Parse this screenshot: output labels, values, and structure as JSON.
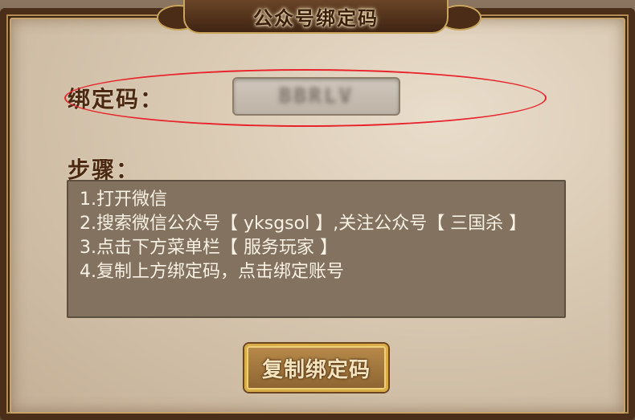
{
  "dialog": {
    "title": "公众号绑定码"
  },
  "code_row": {
    "label": "绑定码：",
    "value": "BBRLV"
  },
  "steps": {
    "label": "步骤：",
    "items": [
      "1.打开微信",
      "2.搜索微信公众号【 yksgsol 】,关注公众号【 三国杀 】",
      "3.点击下方菜单栏【 服务玩家 】",
      "4.复制上方绑定码，点击绑定账号"
    ]
  },
  "actions": {
    "copy_button_label": "复制绑定码"
  },
  "colors": {
    "highlight": "#e8232b",
    "title_text": "#3a1f0e",
    "steps_background": "#82725f"
  }
}
